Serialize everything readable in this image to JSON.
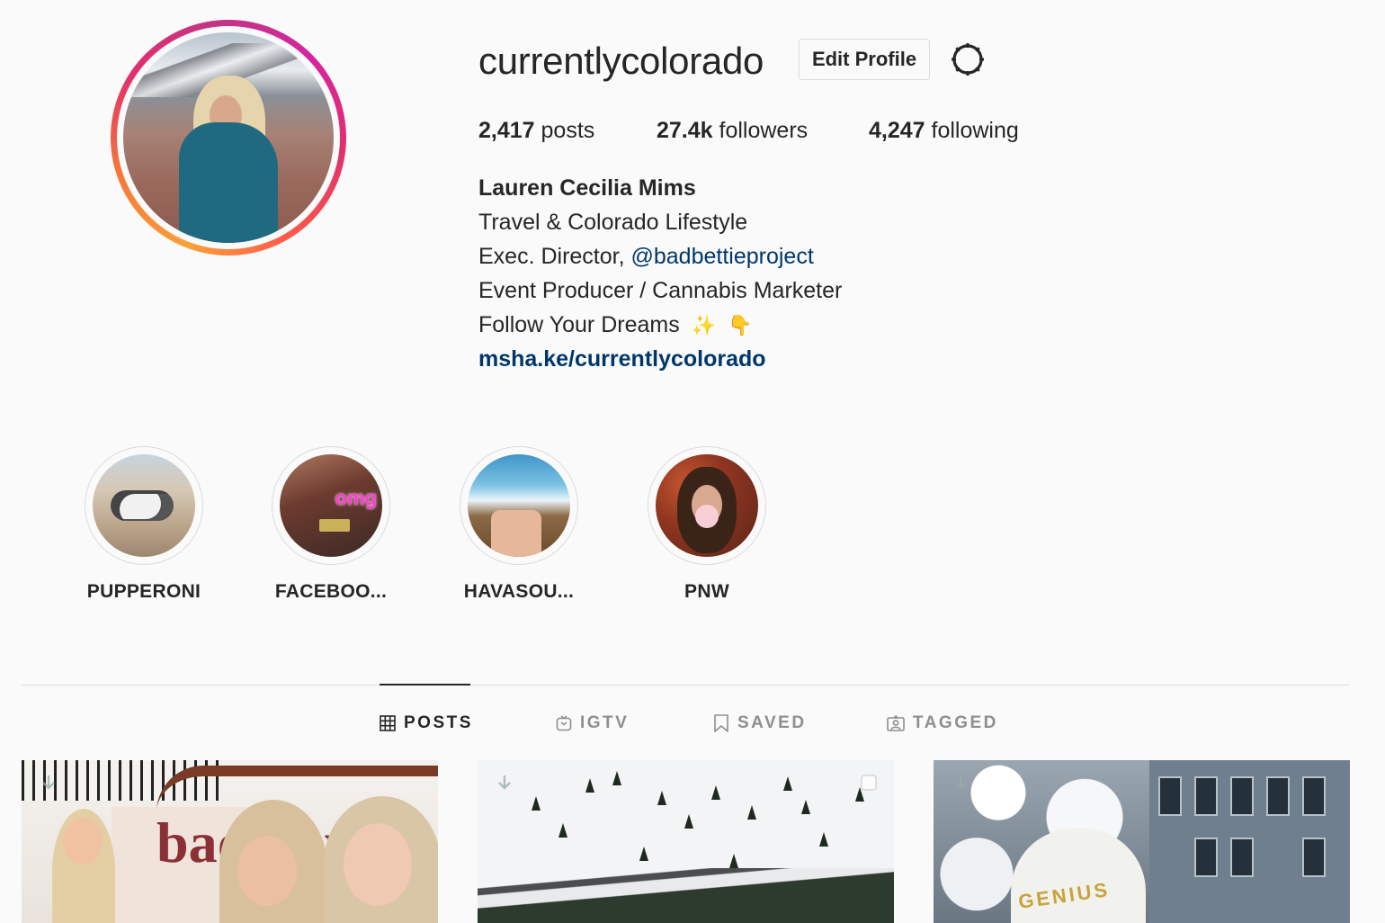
{
  "profile": {
    "username": "currentlycolorado",
    "edit_label": "Edit Profile",
    "stats": [
      {
        "value": "2,417",
        "label": "posts"
      },
      {
        "value": "27.4k",
        "label": "followers"
      },
      {
        "value": "4,247",
        "label": "following"
      }
    ],
    "bio": {
      "name": "Lauren Cecilia Mims",
      "line1": "Travel & Colorado Lifestyle",
      "line2_prefix": "Exec. Director, ",
      "line2_mention": "@badbettieproject",
      "line3": "Event Producer / Cannabis Marketer",
      "line4": "Follow Your Dreams",
      "line4_emoji_1": "✨",
      "line4_emoji_2": "👇",
      "link": "msha.ke/currentlycolorado"
    }
  },
  "highlights": [
    {
      "label": "PUPPERONI"
    },
    {
      "label": "FACEBOO..."
    },
    {
      "label": "HAVASOU..."
    },
    {
      "label": "PNW"
    }
  ],
  "highlight_image_text": {
    "omg": "omg"
  },
  "tabs": [
    {
      "label": "POSTS",
      "icon": "grid-icon",
      "active": true
    },
    {
      "label": "IGTV",
      "icon": "igtv-icon",
      "active": false
    },
    {
      "label": "SAVED",
      "icon": "bookmark-icon",
      "active": false
    },
    {
      "label": "TAGGED",
      "icon": "tagged-icon",
      "active": false
    }
  ],
  "posts": {
    "post1_text": "bad day",
    "post3_text": "GENIUS"
  },
  "colors": {
    "text": "#262626",
    "muted": "#8e8e8e",
    "link": "#00376b",
    "border": "#dbdbdb",
    "background": "#fafafa"
  }
}
